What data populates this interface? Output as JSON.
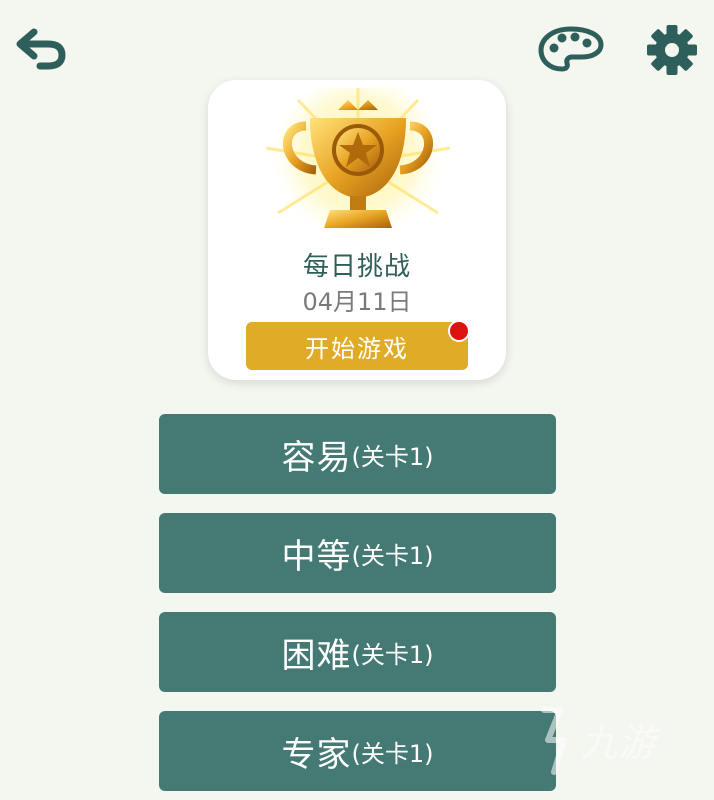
{
  "header": {
    "back_icon": "back-arrow-icon",
    "theme_icon": "palette-icon",
    "settings_icon": "gear-icon"
  },
  "daily_challenge": {
    "icon": "trophy-icon",
    "title": "每日挑战",
    "date": "04月11日",
    "start_label": "开始游戏",
    "has_notification": true
  },
  "levels": [
    {
      "name": "容易",
      "sub": "(关卡1)"
    },
    {
      "name": "中等",
      "sub": "(关卡1)"
    },
    {
      "name": "困难",
      "sub": "(关卡1)"
    },
    {
      "name": "专家",
      "sub": "(关卡1)"
    }
  ],
  "watermark": {
    "text": "九游"
  },
  "colors": {
    "background": "#f4f6f0",
    "accent_teal": "#447a73",
    "gold": "#e0ac28",
    "notification": "#e01010"
  }
}
